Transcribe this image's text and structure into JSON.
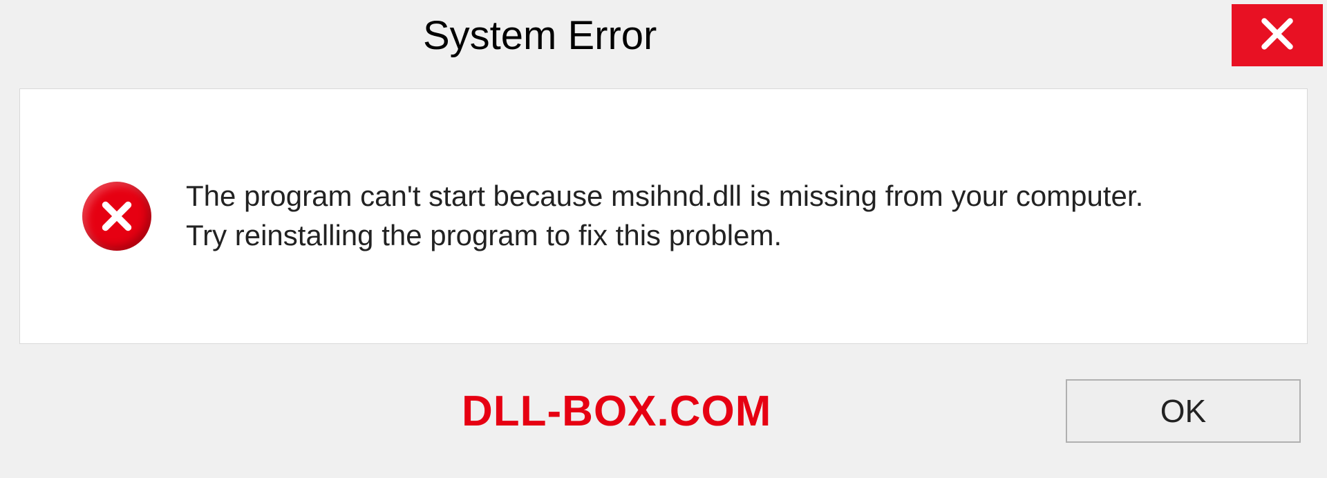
{
  "title": "System Error",
  "message": {
    "line1": "The program can't start because msihnd.dll is missing from your computer.",
    "line2": "Try reinstalling the program to fix this problem."
  },
  "watermark": "DLL-BOX.COM",
  "buttons": {
    "ok": "OK"
  }
}
